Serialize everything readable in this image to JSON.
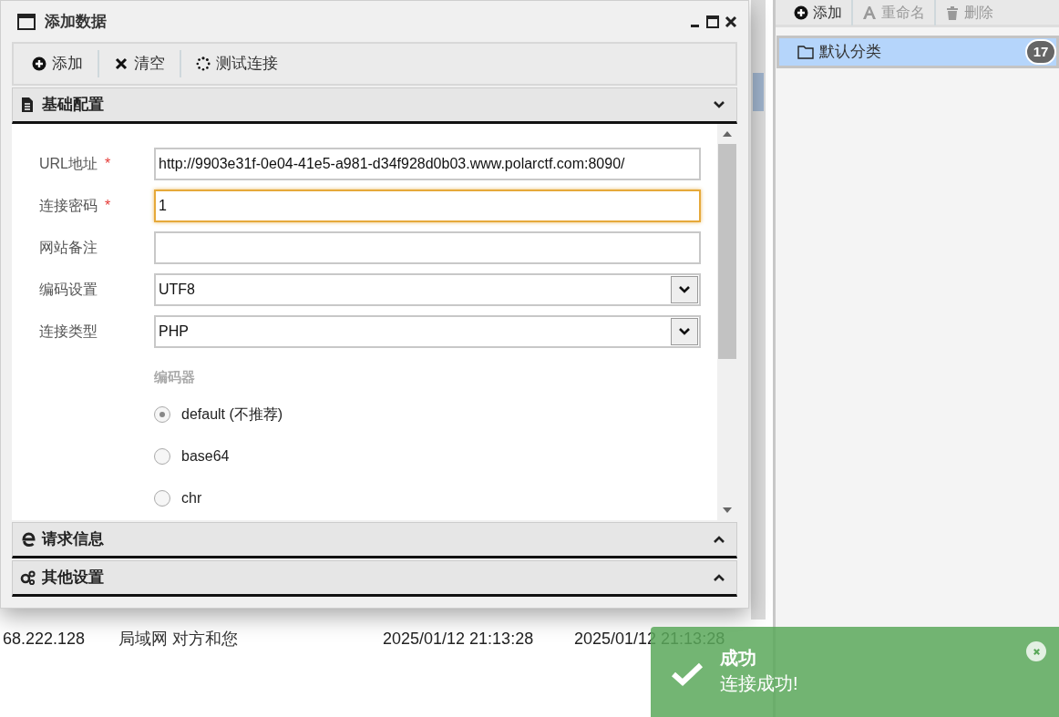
{
  "dialog": {
    "title": "添加数据",
    "toolbar": [
      {
        "kind": "add",
        "label": "添加"
      },
      {
        "kind": "clear",
        "label": "清空"
      },
      {
        "kind": "test",
        "label": "测试连接"
      }
    ],
    "sections": [
      {
        "kind": "doc",
        "title": "基础配置",
        "expanded": true
      },
      {
        "kind": "web",
        "title": "请求信息",
        "expanded": false
      },
      {
        "kind": "gears",
        "title": "其他设置",
        "expanded": false
      }
    ],
    "fields": [
      {
        "kind": "text",
        "label": "URL地址",
        "required_mark": "*",
        "value": "http://9903e31f-0e04-41e5-a981-d34f928d0b03.www.polarctf.com:8090/",
        "focused": false
      },
      {
        "kind": "text",
        "label": "连接密码",
        "required_mark": "*",
        "value": "1",
        "focused": true
      },
      {
        "kind": "text",
        "label": "网站备注",
        "focused": false
      },
      {
        "kind": "select",
        "label": "编码设置",
        "value": "UTF8"
      },
      {
        "kind": "select",
        "label": "连接类型",
        "value": "PHP"
      }
    ],
    "encoder": {
      "label": "编码器",
      "options": [
        {
          "label": "default (不推荐)",
          "selected": true
        },
        {
          "label": "base64",
          "selected": false
        },
        {
          "label": "chr",
          "selected": false
        }
      ]
    }
  },
  "background_row": [
    "68.222.128",
    "局域网 对方和您",
    "2025/01/12 21:13:28",
    "2025/01/12 21:13:28"
  ],
  "side_panel": {
    "toolbar": [
      {
        "kind": "add",
        "label": "添加",
        "disabled": false
      },
      {
        "kind": "rename",
        "label": "重命名",
        "disabled": true
      },
      {
        "kind": "delete",
        "label": "删除",
        "disabled": true
      }
    ],
    "categories": [
      {
        "label": "默认分类",
        "count": "17",
        "selected": true
      }
    ]
  },
  "toast": {
    "title": "成功",
    "message": "连接成功!"
  }
}
